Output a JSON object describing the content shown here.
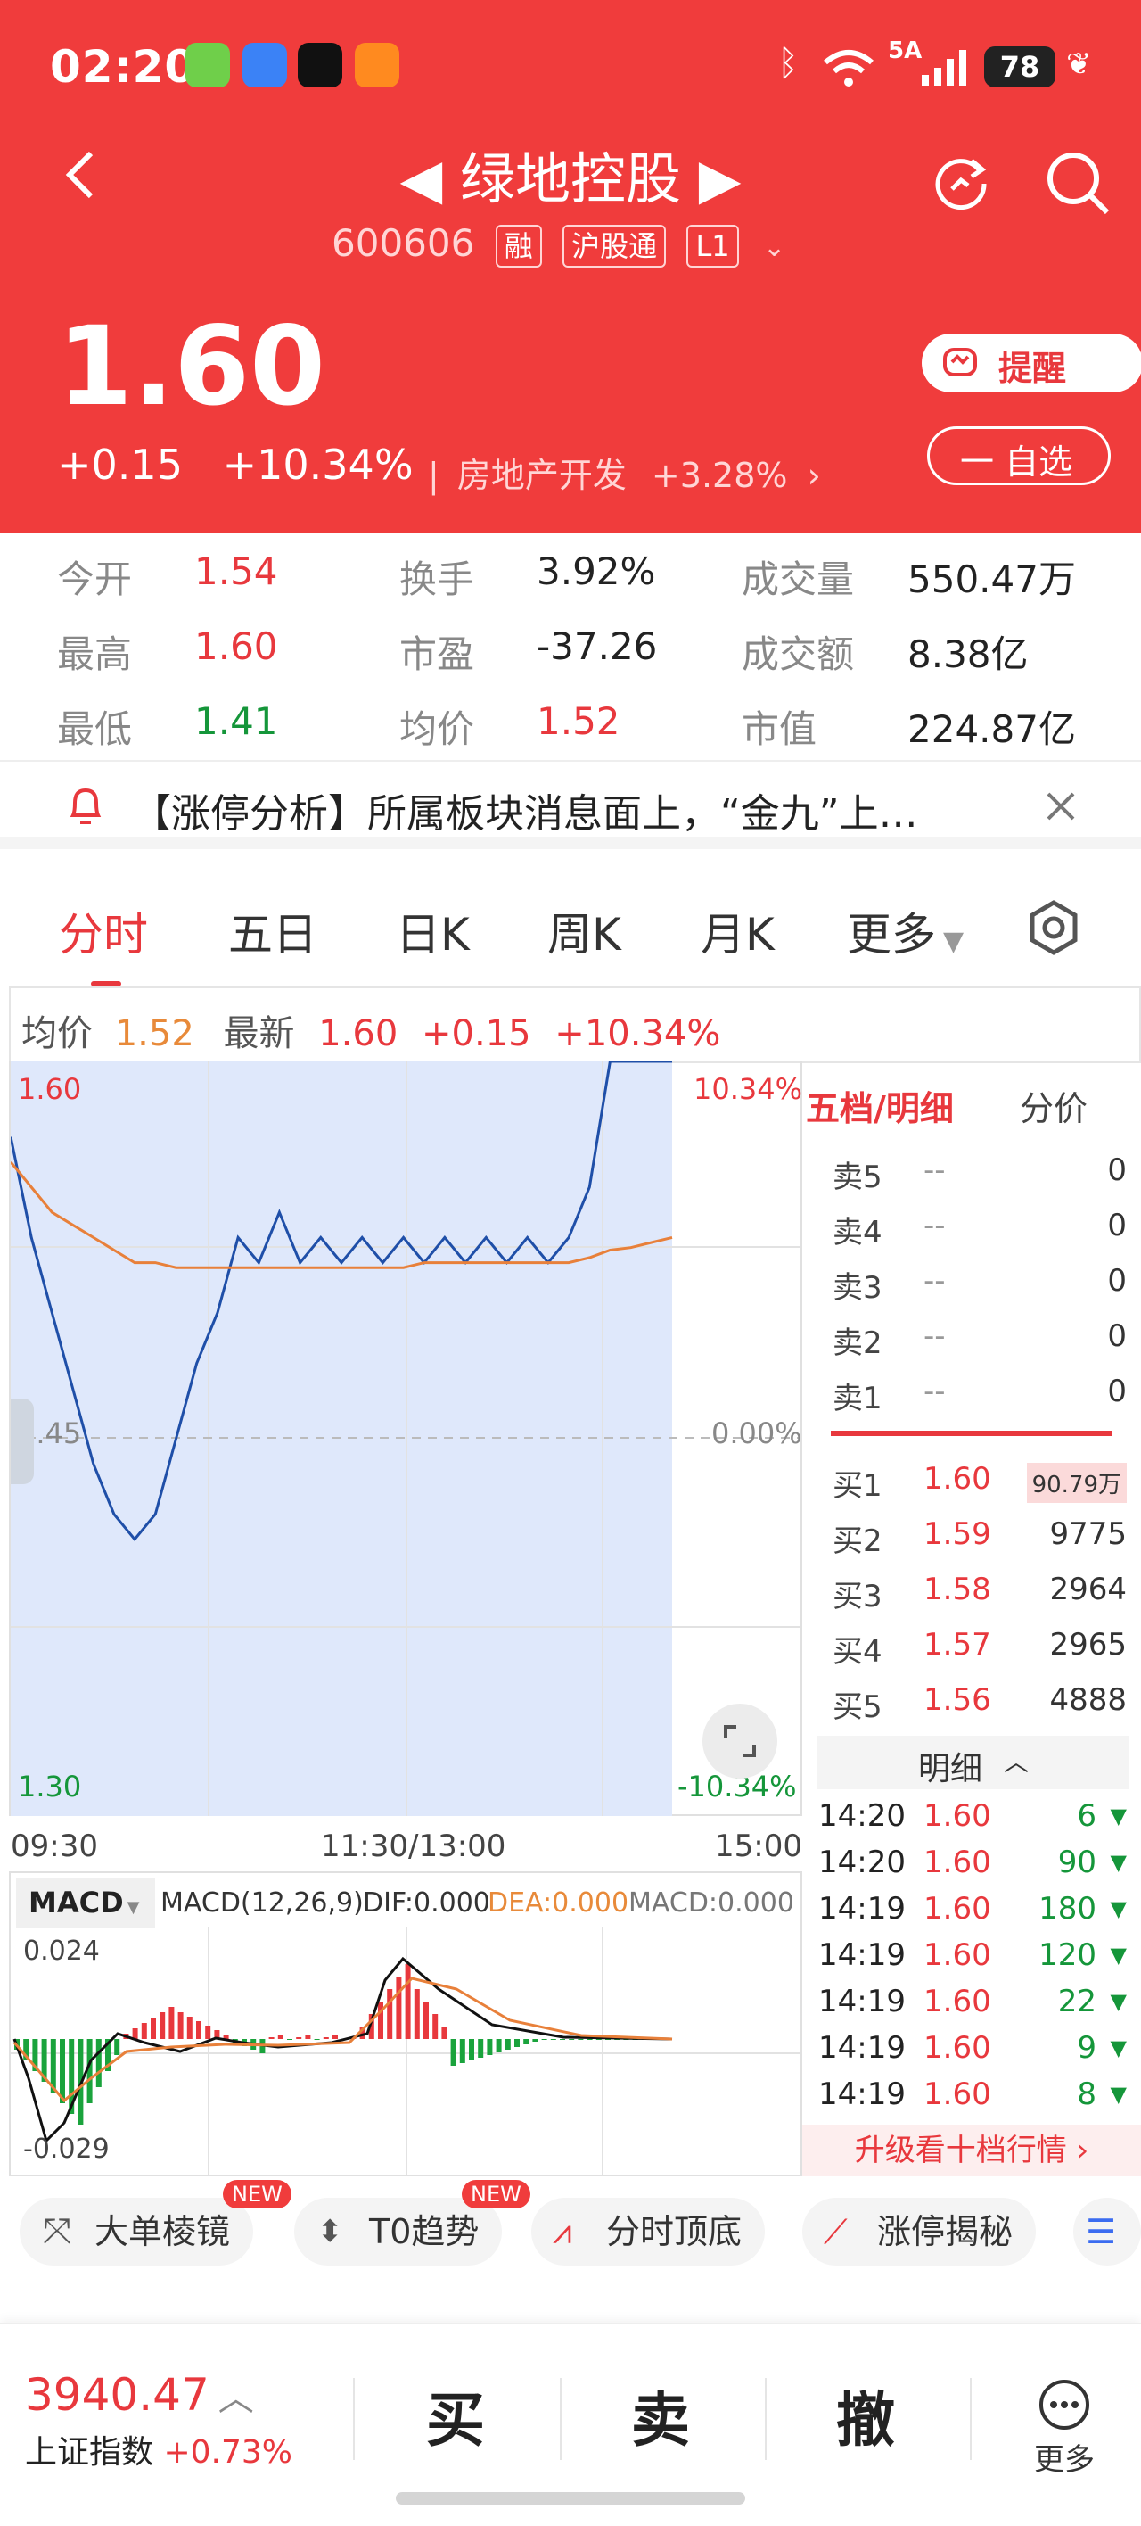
{
  "status": {
    "time": "02:20",
    "net": "5A",
    "battery": "78"
  },
  "header": {
    "title": "◀ 绿地控股 ▶",
    "code": "600606",
    "tags": [
      "融",
      "沪股通",
      "L1"
    ],
    "price": "1.60",
    "change": "+0.15",
    "change_pct": "+10.34%",
    "sector": "房地产开发",
    "sector_pct": "+3.28%",
    "remind_label": "提醒",
    "watch_label": "一 自选"
  },
  "stats": [
    {
      "label": "今开",
      "value": "1.54",
      "color": "red"
    },
    {
      "label": "换手",
      "value": "3.92%",
      "color": "dark"
    },
    {
      "label": "成交量",
      "value": "550.47万",
      "color": "dark"
    },
    {
      "label": "最高",
      "value": "1.60",
      "color": "red"
    },
    {
      "label": "市盈",
      "value": "-37.26",
      "color": "dark"
    },
    {
      "label": "成交额",
      "value": "8.38亿",
      "color": "dark"
    },
    {
      "label": "最低",
      "value": "1.41",
      "color": "green"
    },
    {
      "label": "均价",
      "value": "1.52",
      "color": "red"
    },
    {
      "label": "市值",
      "value": "224.87亿",
      "color": "dark"
    }
  ],
  "notice": {
    "text": "【涨停分析】所属板块消息面上，“金九”上…"
  },
  "tabs": [
    "分时",
    "五日",
    "日K",
    "周K",
    "月K",
    "更多"
  ],
  "infobar": {
    "avg_label": "均价",
    "avg": "1.52",
    "latest_label": "最新",
    "latest": "1.60",
    "chg": "+0.15",
    "pct": "+10.34%"
  },
  "chart": {
    "y_top": "1.60",
    "y_mid": "1.45",
    "y_bot": "1.30",
    "pct_top": "10.34%",
    "pct_mid": "0.00%",
    "pct_bot": "-10.34%",
    "x_labels": [
      "09:30",
      "11:30/13:00",
      "15:00"
    ]
  },
  "chart_data": {
    "type": "line",
    "title": "",
    "x_range": [
      "09:30",
      "15:00"
    ],
    "ylim": [
      1.3,
      1.6
    ],
    "series": [
      {
        "name": "最新",
        "values": [
          1.57,
          1.53,
          1.5,
          1.47,
          1.44,
          1.42,
          1.41,
          1.42,
          1.45,
          1.48,
          1.5,
          1.53,
          1.52,
          1.54,
          1.52,
          1.53,
          1.52,
          1.53,
          1.52,
          1.53,
          1.52,
          1.53,
          1.52,
          1.53,
          1.52,
          1.53,
          1.52,
          1.53,
          1.55,
          1.6,
          1.6,
          1.6,
          1.6
        ]
      },
      {
        "name": "均价",
        "values": [
          1.56,
          1.55,
          1.54,
          1.535,
          1.53,
          1.525,
          1.52,
          1.52,
          1.518,
          1.518,
          1.518,
          1.518,
          1.518,
          1.518,
          1.518,
          1.518,
          1.518,
          1.518,
          1.518,
          1.518,
          1.52,
          1.52,
          1.52,
          1.52,
          1.52,
          1.52,
          1.52,
          1.52,
          1.522,
          1.525,
          1.526,
          1.528,
          1.53
        ]
      }
    ]
  },
  "macd": {
    "label": "MACD",
    "params": "MACD(12,26,9)",
    "dif": "DIF:0.000",
    "dea": "DEA:0.000",
    "macd": "MACD:0.000",
    "top": "0.024",
    "bot": "-0.029"
  },
  "orderbook": {
    "title": "五档/明细",
    "alt": "分价",
    "asks": [
      {
        "l": "卖5",
        "p": "--",
        "v": "0"
      },
      {
        "l": "卖4",
        "p": "--",
        "v": "0"
      },
      {
        "l": "卖3",
        "p": "--",
        "v": "0"
      },
      {
        "l": "卖2",
        "p": "--",
        "v": "0"
      },
      {
        "l": "卖1",
        "p": "--",
        "v": "0"
      }
    ],
    "bids": [
      {
        "l": "买1",
        "p": "1.60",
        "v": "90.79万"
      },
      {
        "l": "买2",
        "p": "1.59",
        "v": "9775"
      },
      {
        "l": "买3",
        "p": "1.58",
        "v": "2964"
      },
      {
        "l": "买4",
        "p": "1.57",
        "v": "2965"
      },
      {
        "l": "买5",
        "p": "1.56",
        "v": "4888"
      }
    ],
    "detail_label": "明细",
    "trades": [
      {
        "t": "14:20",
        "p": "1.60",
        "v": "6"
      },
      {
        "t": "14:20",
        "p": "1.60",
        "v": "90"
      },
      {
        "t": "14:19",
        "p": "1.60",
        "v": "180"
      },
      {
        "t": "14:19",
        "p": "1.60",
        "v": "120"
      },
      {
        "t": "14:19",
        "p": "1.60",
        "v": "22"
      },
      {
        "t": "14:19",
        "p": "1.60",
        "v": "9"
      },
      {
        "t": "14:19",
        "p": "1.60",
        "v": "8"
      }
    ],
    "upgrade": "升级看十档行情"
  },
  "tools": [
    {
      "label": "大单棱镜",
      "new": "NEW"
    },
    {
      "label": "T0趋势",
      "new": "NEW"
    },
    {
      "label": "分时顶底"
    },
    {
      "label": "涨停揭秘"
    }
  ],
  "bottom": {
    "index_value": "3940.47",
    "index_name": "上证指数",
    "index_pct": "+0.73%",
    "buy": "买",
    "sell": "卖",
    "cancel": "撤",
    "more": "更多"
  }
}
